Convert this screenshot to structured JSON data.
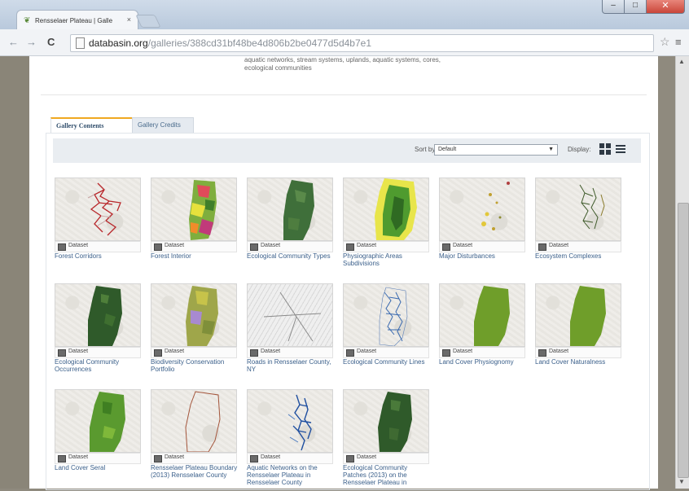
{
  "browser": {
    "tab_title": "Rensselaer Plateau | Galle",
    "tab_close": "×",
    "url_host": "databasin.org",
    "url_path": "/galleries/388cd31bf48be4d806b2be0477d5d4b7e1",
    "close_glyph": "✕"
  },
  "page": {
    "description": "aquatic networks, stream systems, uplands, aquatic systems, cores, ecological communities"
  },
  "gallery_tabs": [
    {
      "label": "Gallery Contents",
      "active": true
    },
    {
      "label": "Gallery Credits",
      "active": false
    }
  ],
  "controls": {
    "sort_label": "Sort by:",
    "sort_value": "Default",
    "display_label": "Display:"
  },
  "items": [
    {
      "title": "Forest Corridors",
      "type": "Dataset"
    },
    {
      "title": "Forest Interior",
      "type": "Dataset"
    },
    {
      "title": "Ecological Community Types",
      "type": "Dataset"
    },
    {
      "title": "Physiographic Areas Subdivisions",
      "type": "Dataset"
    },
    {
      "title": "Major Disturbances",
      "type": "Dataset"
    },
    {
      "title": "Ecosystem Complexes",
      "type": "Dataset"
    },
    {
      "title": "Ecological Community Occurrences",
      "type": "Dataset"
    },
    {
      "title": "Biodiversity Conservation Portfolio",
      "type": "Dataset"
    },
    {
      "title": "Roads in Rensselaer County, NY",
      "type": "Dataset"
    },
    {
      "title": "Ecological Community Lines",
      "type": "Dataset"
    },
    {
      "title": "Land Cover Physiognomy",
      "type": "Dataset"
    },
    {
      "title": "Land Cover Naturalness",
      "type": "Dataset"
    },
    {
      "title": "Land Cover Seral",
      "type": "Dataset"
    },
    {
      "title": "Rensselaer Plateau Boundary (2013) Rensselaer County",
      "type": "Dataset"
    },
    {
      "title": "Aquatic Networks on the Rensselaer Plateau in Rensselaer County",
      "type": "Dataset"
    },
    {
      "title": "Ecological Community Patches (2013) on the Rensselaer Plateau in",
      "type": "Dataset"
    }
  ],
  "colors": {
    "link": "#3a5f8a",
    "active_tab_accent": "#f0a820"
  }
}
